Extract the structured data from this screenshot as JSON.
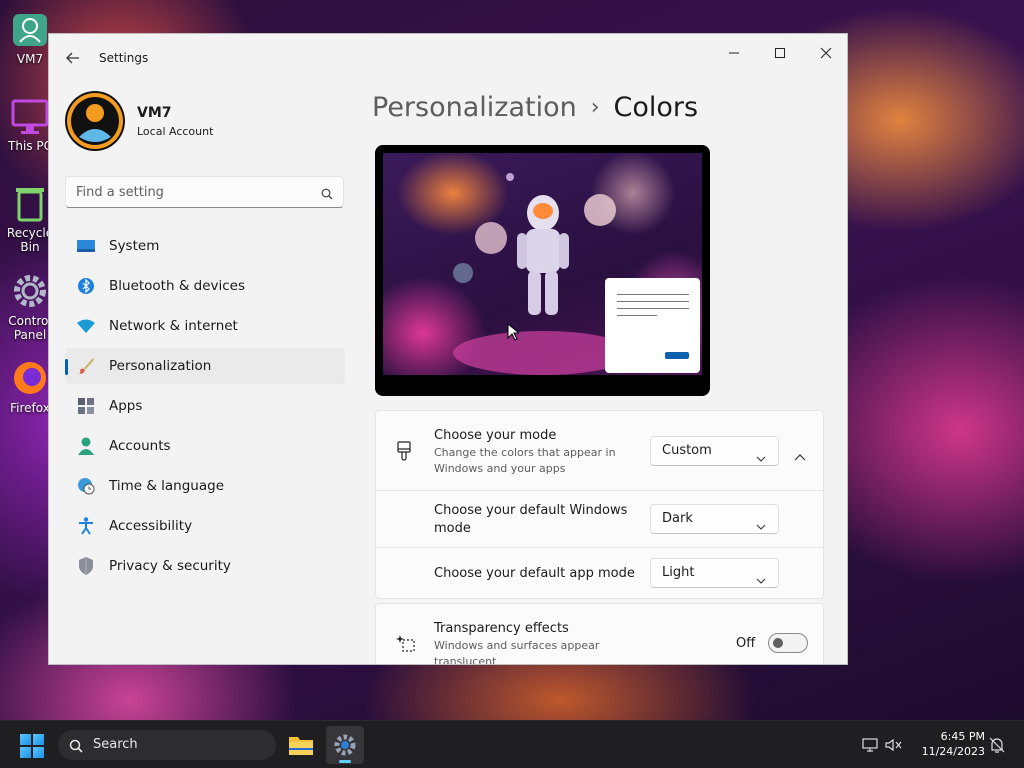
{
  "desktop": {
    "icons": [
      {
        "label": "VM7"
      },
      {
        "label": "This PC"
      },
      {
        "label": "Recycle Bin"
      },
      {
        "label": "Control Panel"
      },
      {
        "label": "Firefox"
      }
    ]
  },
  "window": {
    "title": "Settings",
    "profile": {
      "name": "VM7",
      "account_type": "Local Account"
    },
    "search": {
      "placeholder": "Find a setting"
    },
    "nav": [
      {
        "label": "System",
        "icon": "monitor-icon"
      },
      {
        "label": "Bluetooth & devices",
        "icon": "bluetooth-icon"
      },
      {
        "label": "Network & internet",
        "icon": "wifi-icon"
      },
      {
        "label": "Personalization",
        "icon": "brush-icon",
        "active": true
      },
      {
        "label": "Apps",
        "icon": "apps-icon"
      },
      {
        "label": "Accounts",
        "icon": "person-icon"
      },
      {
        "label": "Time & language",
        "icon": "globe-clock-icon"
      },
      {
        "label": "Accessibility",
        "icon": "accessibility-icon"
      },
      {
        "label": "Privacy & security",
        "icon": "shield-icon"
      }
    ],
    "breadcrumb": {
      "parent": "Personalization",
      "separator": "›",
      "current": "Colors"
    },
    "settings": {
      "mode": {
        "title": "Choose your mode",
        "desc_line1": "Change the colors that appear in",
        "desc_line2": "Windows and your apps",
        "value": "Custom"
      },
      "windows_mode": {
        "title_line1": "Choose your default Windows",
        "title_line2": "mode",
        "value": "Dark"
      },
      "app_mode": {
        "title": "Choose your default app mode",
        "value": "Light"
      },
      "transparency": {
        "title": "Transparency effects",
        "desc_line1": "Windows and surfaces appear",
        "desc_line2": "translucent",
        "state": "Off"
      }
    }
  },
  "taskbar": {
    "search_label": "Search",
    "time": "6:45 PM",
    "date": "11/24/2023"
  },
  "colors": {
    "accent": "#005fb8",
    "taskbar": "#1f1f22",
    "window_bg": "#f3f3f3"
  }
}
